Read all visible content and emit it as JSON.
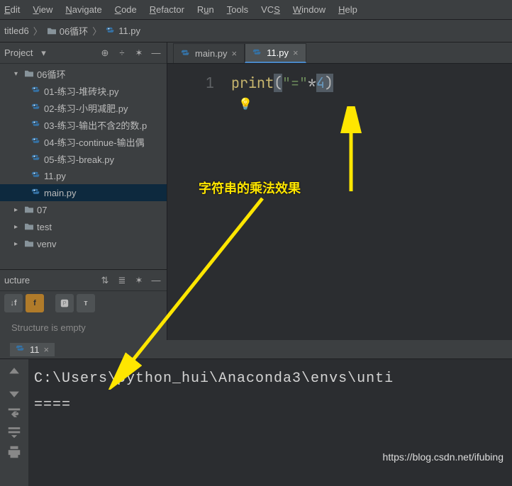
{
  "menu": {
    "edit": "Edit",
    "view": "View",
    "navigate": "Navigate",
    "code": "Code",
    "refactor": "Refactor",
    "run": "Run",
    "tools": "Tools",
    "vcs": "VCS",
    "window": "Window",
    "help": "Help"
  },
  "breadcrumb": {
    "project": "titled6",
    "folder": "06循环",
    "file": "11.py"
  },
  "project_panel": {
    "title": "Project",
    "root": "06循环",
    "files": [
      "01-练习-堆砖块.py",
      "02-练习-小明减肥.py",
      "03-练习-输出不含2的数.p",
      "04-练习-continue-输出偶",
      "05-练习-break.py",
      "11.py",
      "main.py"
    ],
    "siblings": [
      "07",
      "test",
      "venv"
    ]
  },
  "structure_panel": {
    "title": "ucture",
    "empty": "Structure is empty"
  },
  "editor": {
    "tabs": [
      {
        "label": "main.py",
        "active": false
      },
      {
        "label": "11.py",
        "active": true
      }
    ],
    "linenum": "1",
    "code": {
      "call": "print",
      "lpar": "(",
      "str": "\"=\"",
      "op": "*",
      "num": "4",
      "rpar": ")"
    },
    "annotation": "字符串的乘法效果"
  },
  "run": {
    "tab": "11",
    "line1": "C:\\Users\\python_hui\\Anaconda3\\envs\\unti",
    "line2": "===="
  },
  "watermark": "https://blog.csdn.net/ifubing"
}
